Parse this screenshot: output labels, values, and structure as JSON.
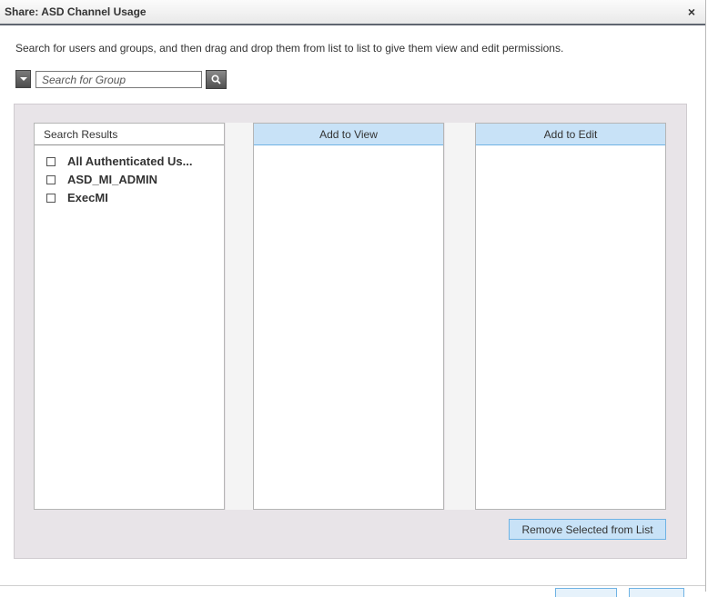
{
  "dialog": {
    "title": "Share: ASD Channel Usage",
    "close_symbol": "×",
    "instructions": "Search for users and groups, and then drag and drop them from list to list to give them view and edit permissions."
  },
  "search": {
    "placeholder": "Search for Group",
    "value": "",
    "dropdown_icon": "chevron-down-icon",
    "button_icon": "magnifier-icon"
  },
  "columns": {
    "results": {
      "header": "Search Results",
      "items": [
        {
          "label": "All Authenticated Us...",
          "checked": false
        },
        {
          "label": "ASD_MI_ADMIN",
          "checked": false
        },
        {
          "label": "ExecMI",
          "checked": false
        }
      ]
    },
    "view": {
      "header": "Add to View",
      "items": []
    },
    "edit": {
      "header": "Add to Edit",
      "items": []
    }
  },
  "actions": {
    "remove_label": "Remove Selected from List"
  },
  "colors": {
    "accent_header": "#c8e2f7",
    "accent_border": "#6fb3e4",
    "panel_bg": "#e8e4e8",
    "titlebar_rule": "#5f6670"
  }
}
